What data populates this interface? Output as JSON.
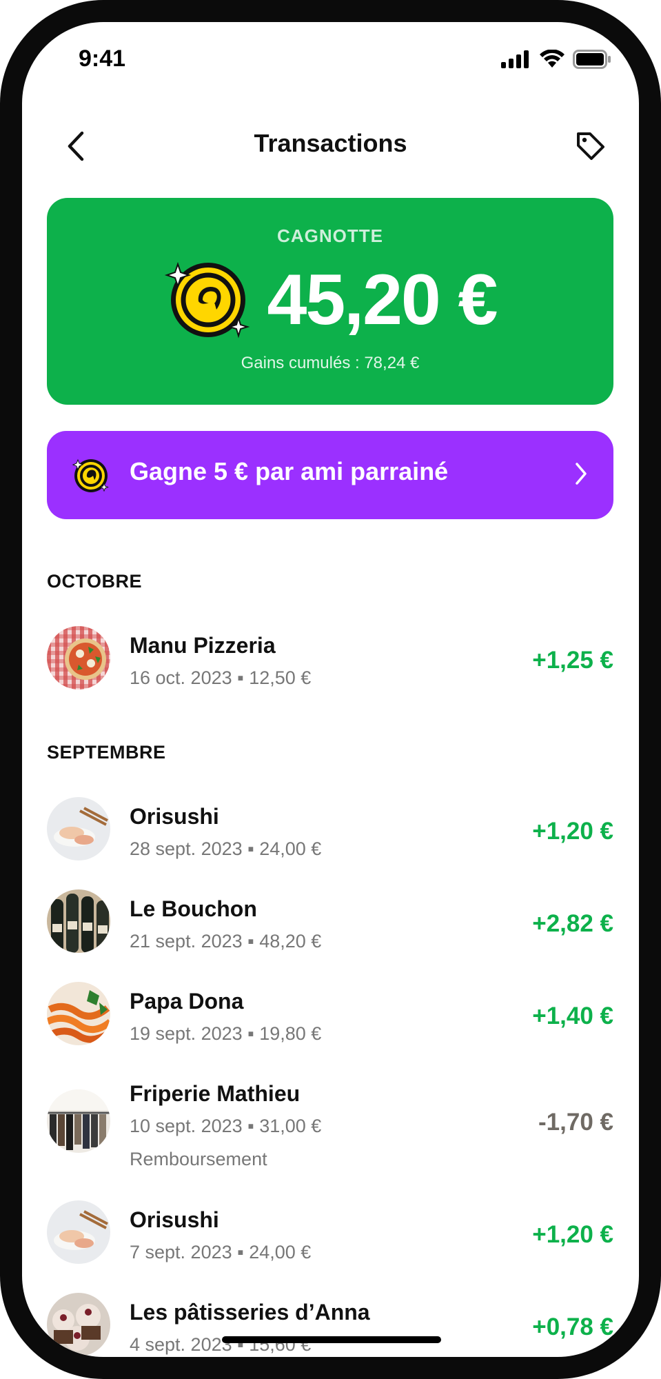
{
  "status_bar": {
    "time": "9:41"
  },
  "header": {
    "title": "Transactions"
  },
  "cagnotte": {
    "label": "CAGNOTTE",
    "amount": "45,20 €",
    "cumulative": "Gains cumulés : 78,24 €"
  },
  "referral": {
    "text": "Gagne 5 € par ami parrainé"
  },
  "sections": [
    {
      "title": "OCTOBRE",
      "transactions": [
        {
          "name": "Manu Pizzeria",
          "meta": "16 oct. 2023 ▪ 12,50 €",
          "amount": "+1,25 €",
          "amount_color": "#0db14b",
          "extra": ""
        }
      ]
    },
    {
      "title": "SEPTEMBRE",
      "transactions": [
        {
          "name": "Orisushi",
          "meta": "28 sept. 2023 ▪ 24,00 €",
          "amount": "+1,20 €",
          "amount_color": "#0db14b",
          "extra": ""
        },
        {
          "name": "Le Bouchon",
          "meta": "21 sept. 2023 ▪ 48,20 €",
          "amount": "+2,82 €",
          "amount_color": "#0db14b",
          "extra": ""
        },
        {
          "name": "Papa Dona",
          "meta": "19 sept. 2023 ▪ 19,80 €",
          "amount": "+1,40 €",
          "amount_color": "#0db14b",
          "extra": ""
        },
        {
          "name": "Friperie Mathieu",
          "meta": "10 sept. 2023 ▪ 31,00 €",
          "amount": "-1,70 €",
          "amount_color": "#6f6a64",
          "extra": "Remboursement"
        },
        {
          "name": "Orisushi",
          "meta": "7 sept. 2023 ▪ 24,00 €",
          "amount": "+1,20 €",
          "amount_color": "#0db14b",
          "extra": ""
        },
        {
          "name": "Les pâtisseries d’Anna",
          "meta": "4 sept. 2023 ▪ 15,60 €",
          "amount": "+0,78 €",
          "amount_color": "#0db14b",
          "extra": ""
        }
      ]
    }
  ],
  "colors": {
    "green": "#0db14b",
    "purple": "#9b30ff",
    "refund_gray": "#6f6a64"
  },
  "icons": [
    "back-chevron-icon",
    "tag-icon",
    "coin-icon",
    "chevron-right-icon",
    "signal-icon",
    "wifi-icon",
    "battery-icon"
  ]
}
